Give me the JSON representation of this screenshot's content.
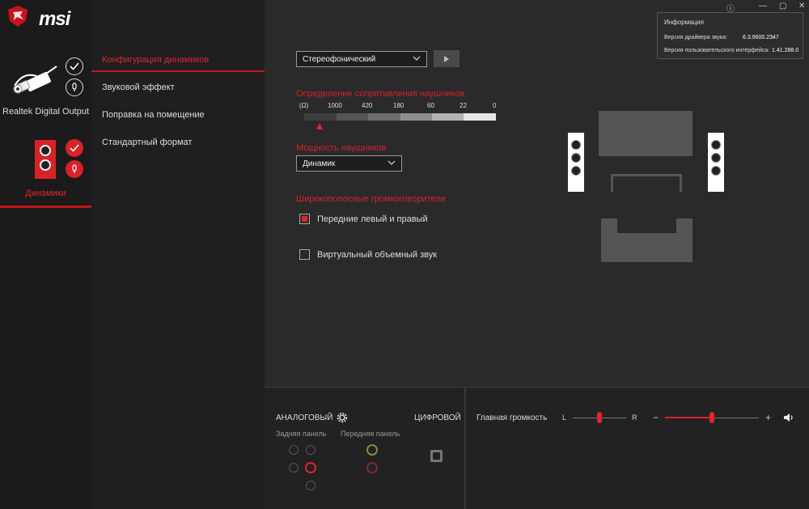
{
  "brand": {
    "logo_text": "msi"
  },
  "devices": [
    {
      "label": "Realtek Digital Output"
    },
    {
      "label": "Динамики"
    }
  ],
  "menu": {
    "items": [
      {
        "label": "Конфигурация динамиков"
      },
      {
        "label": "Звуковой эффект"
      },
      {
        "label": "Поправка на помещение"
      },
      {
        "label": "Стандартный формат"
      }
    ]
  },
  "speaker_config": {
    "selected": "Стереофонический"
  },
  "impedance": {
    "title": "Определение сопротивления наушников",
    "unit": "(Ω)",
    "ticks": [
      "1000",
      "420",
      "180",
      "60",
      "22",
      "0"
    ]
  },
  "headphone_power": {
    "title": "Мощность наушников",
    "selected": "Динамик"
  },
  "fullrange": {
    "title": "Широкополосные громкоговорители",
    "front_lr_label": "Передние левый и правый",
    "front_lr_checked": true
  },
  "virtual_surround": {
    "label": "Виртуальный объемный звук",
    "checked": false
  },
  "info": {
    "title": "Информация",
    "driver_label": "Версия драйвера звука:",
    "driver_value": "6.3.9600.2347",
    "ui_label": "Версия пользовательского интерфейса:",
    "ui_value": "1.41.288.0"
  },
  "bottom": {
    "analog_label": "АНАЛОГОВЫЙ",
    "digital_label": "ЦИФРОВОЙ",
    "rear_panel": "Задняя панель",
    "front_panel": "Передняя панель",
    "volume_label": "Главная громкость",
    "balance_left": "L",
    "balance_right": "R",
    "vol_minus": "−",
    "vol_plus": "+",
    "balance_level": 0.5,
    "volume_level": 0.5
  },
  "colors": {
    "accent": "#d8222a",
    "bg": "#262626"
  }
}
